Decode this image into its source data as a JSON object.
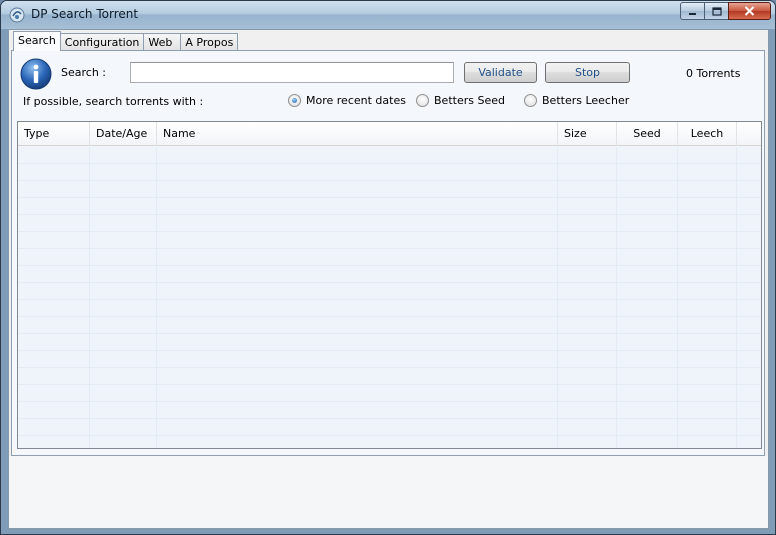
{
  "window": {
    "title": "DP Search Torrent"
  },
  "tabs": [
    {
      "label": "Search"
    },
    {
      "label": "Configuration"
    },
    {
      "label": "Web"
    },
    {
      "label": "A Propos"
    }
  ],
  "search": {
    "label": "Search :",
    "value": "",
    "placeholder": "",
    "validate_label": "Validate",
    "stop_label": "Stop",
    "result_count": "0 Torrents"
  },
  "preferences": {
    "label": "If possible, search torrents with :",
    "options": [
      {
        "label": "More recent dates",
        "selected": true
      },
      {
        "label": "Betters Seed",
        "selected": false
      },
      {
        "label": "Betters Leecher",
        "selected": false
      }
    ]
  },
  "results": {
    "columns": [
      "Type",
      "Date/Age",
      "Name",
      "Size",
      "Seed",
      "Leech"
    ],
    "rows": []
  },
  "colors": {
    "accent": "#1d5ea6",
    "button_text": "#20528a",
    "close_button": "#c9553e"
  },
  "icons": {
    "app": "dp-app-icon",
    "info": "info-icon",
    "minimize": "minimize-icon",
    "maximize": "maximize-icon",
    "close": "close-icon"
  }
}
